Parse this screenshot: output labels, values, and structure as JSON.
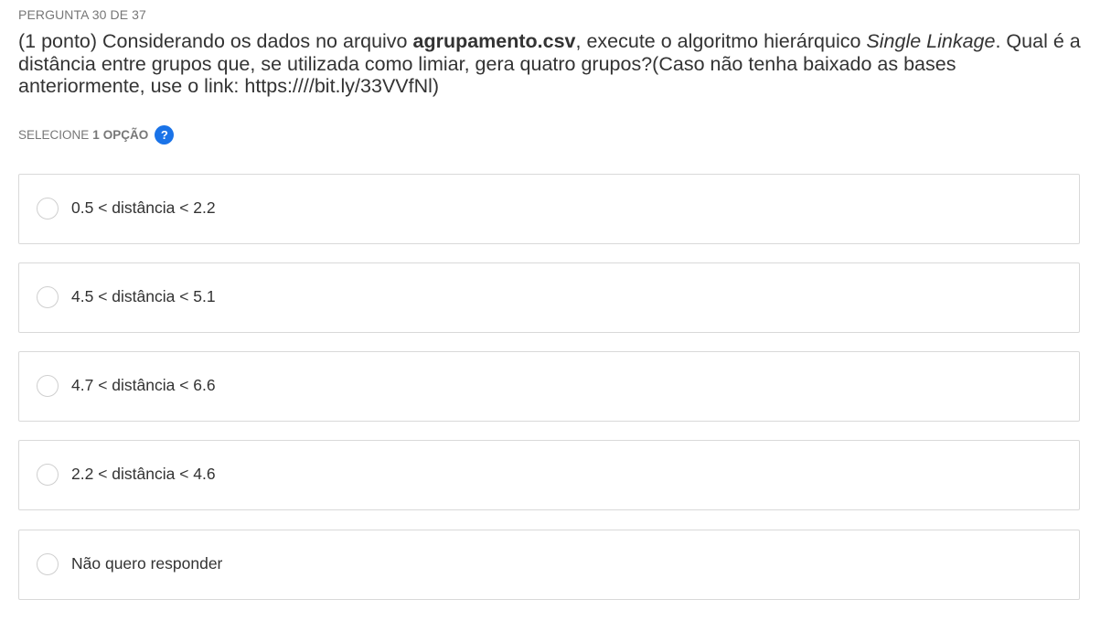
{
  "question": {
    "counter": "PERGUNTA 30 DE 37",
    "text_prefix": "(1 ponto) Considerando os dados no arquivo ",
    "file_name": "agrupamento.csv",
    "text_middle": ", execute o algoritmo hierárquico ",
    "algorithm": "Single Linkage",
    "text_suffix": ". Qual é a distância entre grupos que, se utilizada como limiar, gera quatro grupos?(Caso não tenha baixado as bases anteriormente, use o link: https:////bit.ly/33VVfNl)"
  },
  "selection_hint": {
    "prefix": "SELECIONE",
    "count": "1",
    "suffix": "OPÇÃO",
    "help_icon": "?"
  },
  "options": [
    {
      "label": "0.5 < distância < 2.2",
      "selected": false
    },
    {
      "label": "4.5 < distância < 5.1",
      "selected": false
    },
    {
      "label": "4.7 < distância < 6.6",
      "selected": false
    },
    {
      "label": "2.2 < distância < 4.6",
      "selected": false
    },
    {
      "label": "Não quero responder",
      "selected": false
    }
  ],
  "colors": {
    "accent": "#1a73e8",
    "border": "#d9d9d9",
    "muted_text": "#777777",
    "text": "#333333"
  }
}
